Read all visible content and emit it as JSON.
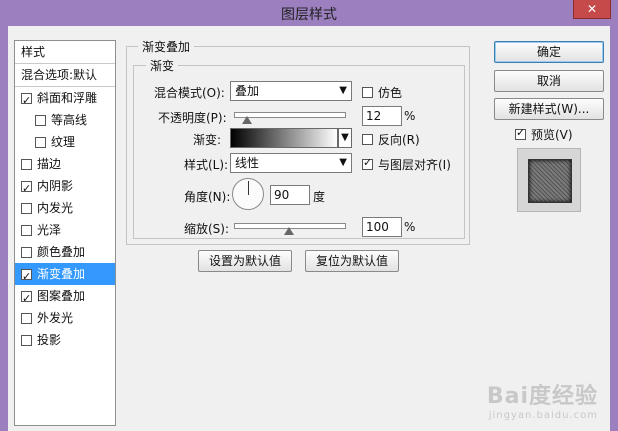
{
  "window": {
    "title": "图层样式",
    "close_label": "✕"
  },
  "styles": {
    "header": "样式",
    "blend_options": "混合选项:默认",
    "items": [
      {
        "label": "斜面和浮雕",
        "checked": true,
        "sub": false
      },
      {
        "label": "等高线",
        "checked": false,
        "sub": true
      },
      {
        "label": "纹理",
        "checked": false,
        "sub": true
      },
      {
        "label": "描边",
        "checked": false,
        "sub": false
      },
      {
        "label": "内阴影",
        "checked": true,
        "sub": false
      },
      {
        "label": "内发光",
        "checked": false,
        "sub": false
      },
      {
        "label": "光泽",
        "checked": false,
        "sub": false
      },
      {
        "label": "颜色叠加",
        "checked": false,
        "sub": false
      },
      {
        "label": "渐变叠加",
        "checked": true,
        "sub": false,
        "selected": true
      },
      {
        "label": "图案叠加",
        "checked": true,
        "sub": false
      },
      {
        "label": "外发光",
        "checked": false,
        "sub": false
      },
      {
        "label": "投影",
        "checked": false,
        "sub": false
      }
    ]
  },
  "gradient_overlay": {
    "section_title": "渐变叠加",
    "group_title": "渐变",
    "blend_mode_label": "混合模式(O):",
    "blend_mode_value": "叠加",
    "dither_label": "仿色",
    "dither_checked": false,
    "opacity_label": "不透明度(P):",
    "opacity_value": "12",
    "opacity_unit": "%",
    "opacity_fraction": 0.12,
    "gradient_label": "渐变:",
    "reverse_label": "反向(R)",
    "reverse_checked": false,
    "style_label": "样式(L):",
    "style_value": "线性",
    "align_label": "与图层对齐(I)",
    "align_checked": true,
    "angle_label": "角度(N):",
    "angle_value": "90",
    "angle_unit": "度",
    "scale_label": "缩放(S):",
    "scale_value": "100",
    "scale_unit": "%",
    "scale_fraction": 0.5,
    "set_default": "设置为默认值",
    "reset_default": "复位为默认值"
  },
  "actions": {
    "ok": "确定",
    "cancel": "取消",
    "new_style": "新建样式(W)...",
    "preview_label": "预览(V)",
    "preview_checked": true
  },
  "watermark": {
    "brand": "Bai度经验",
    "url": "jingyan.baidu.com"
  }
}
